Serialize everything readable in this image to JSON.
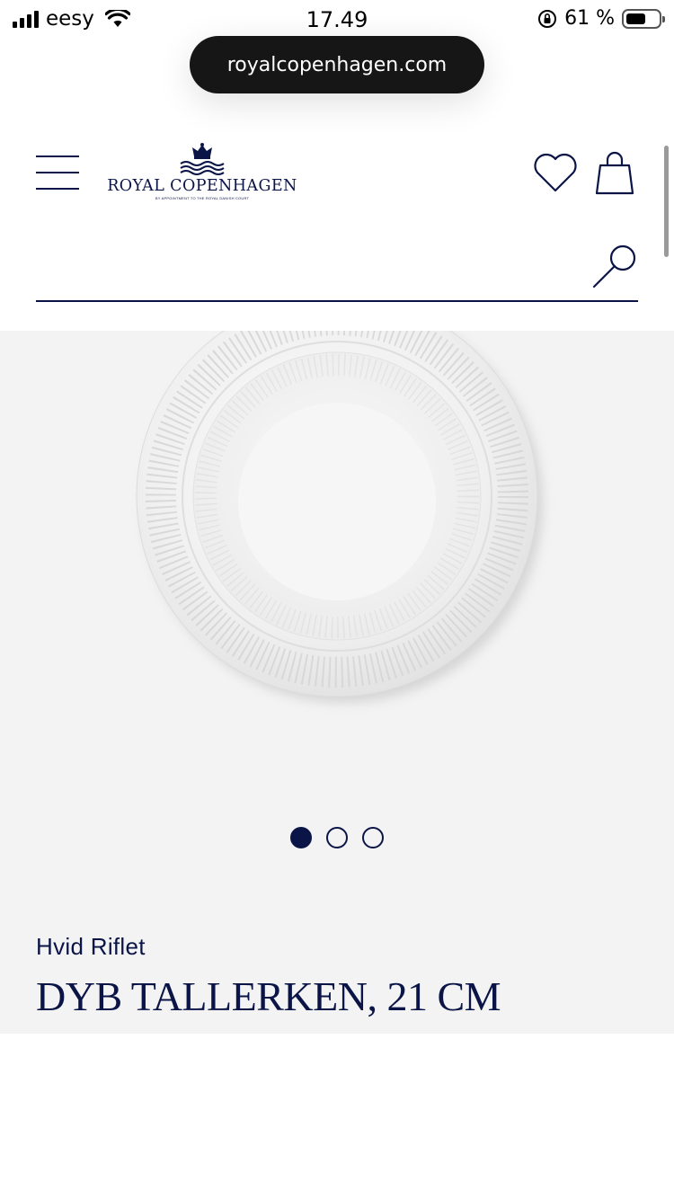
{
  "status_bar": {
    "carrier": "eesy",
    "time": "17.49",
    "battery_percent": "61 %",
    "battery_level": 0.61,
    "icons": [
      "signal-icon",
      "wifi-icon",
      "orientation-lock-icon",
      "battery-icon"
    ]
  },
  "browser": {
    "url": "royalcopenhagen.com"
  },
  "header": {
    "logo_text": "ROYAL COPENHAGEN",
    "logo_subtext": "BY APPOINTMENT TO THE ROYAL DANISH COURT",
    "icons": [
      "menu-icon",
      "heart-icon",
      "shopping-bag-icon"
    ]
  },
  "search": {
    "placeholder": "",
    "value": "",
    "icon": "search-icon"
  },
  "gallery": {
    "image_count": 3,
    "active_index": 0
  },
  "product": {
    "collection": "Hvid Riflet",
    "title": "DYB TALLERKEN, 21 CM"
  },
  "colors": {
    "brand_navy": "#0b1446",
    "gallery_background": "#f3f3f3",
    "url_pill": "#161616"
  }
}
